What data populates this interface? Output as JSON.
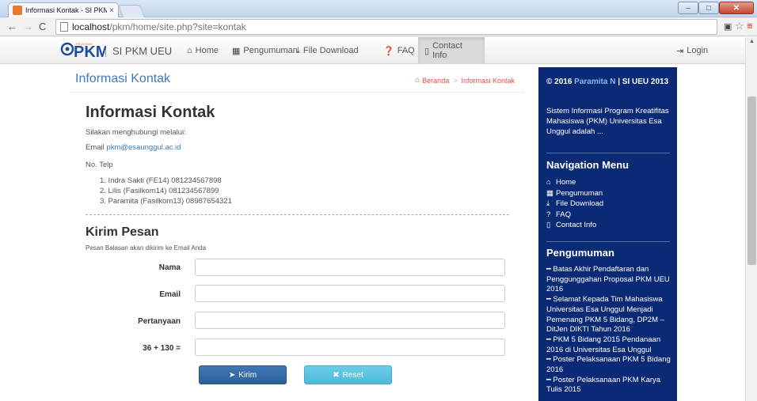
{
  "browser": {
    "tab_title": "Informasi Kontak - SI PKM",
    "tab_close": "×",
    "url_host": "localhost",
    "url_rest": "/pkm/home/site.php?site=kontak"
  },
  "navbar": {
    "brand": "SI PKM UEU",
    "items": [
      {
        "label": "Home",
        "icon": "home-icon"
      },
      {
        "label": "Pengumuman",
        "icon": "grid-icon"
      },
      {
        "label": "File Download",
        "icon": "download-icon"
      },
      {
        "label": "FAQ",
        "icon": "question-icon"
      },
      {
        "label": "Contact Info",
        "icon": "contact-icon"
      }
    ],
    "login": "Login"
  },
  "header": {
    "title": "Informasi Kontak",
    "breadcrumb": [
      "Beranda",
      "Informasi Kontak"
    ]
  },
  "content": {
    "title": "Informasi Kontak",
    "intro": "Silakan menghubungi melalui:",
    "email_label": "Email ",
    "email": "pkm@esaunggul.ac.id",
    "telp_label": "No. Telp",
    "phones": [
      "1. Indra Sakti (FE14) 081234567898",
      "2. Lilis (Fasilkom14) 081234567899",
      "3. Paramita (Fasilkom13) 08987654321"
    ]
  },
  "form": {
    "title": "Kirim Pesan",
    "subtitle": "Pesan Balasan akan dikirim ke Email Anda",
    "fields": [
      {
        "label": "Nama",
        "value": ""
      },
      {
        "label": "Email",
        "value": ""
      },
      {
        "label": "Pertanyaan",
        "value": ""
      },
      {
        "label": "36 + 130 =",
        "value": ""
      }
    ],
    "submit": "Kirim",
    "reset": "Reset"
  },
  "sidebar": {
    "copyright_prefix": "© 2016 ",
    "copyright_author": "Paramita N",
    "copyright_suffix": " | SI UEU 2013",
    "description": "Sistem Informasi Program Kreatifitas Mahasiswa (PKM) Universitas Esa Unggul adalah ...",
    "nav_title": "Navigation Menu",
    "nav_items": [
      "Home",
      "Pengumuman",
      "File Download",
      "FAQ",
      "Contact Info"
    ],
    "news_title": "Pengumuman",
    "news_items": [
      "Batas Akhir Pendaftaran dan Penggunggahan Proposal PKM UEU 2016",
      "Selamat Kepada Tim Mahasiswa Universitas Esa Unggul Menjadi Pemenang PKM 5 Bidang, DP2M – DitJen DIKTI Tahun 2016",
      "PKM 5 Bidang 2015 Pendanaan 2016 di Universitas Esa Unggul",
      "Poster Pelaksanaan PKM 5 Bidang 2016",
      "Poster Pelaksanaan PKM Karya Tulis 2015"
    ]
  },
  "colors": {
    "sidebar_bg": "#0b2a75",
    "link": "#3b7bbf",
    "breadcrumb": "#d9534f",
    "primary_button": "#2d5f96",
    "info_button": "#5bc0de"
  }
}
